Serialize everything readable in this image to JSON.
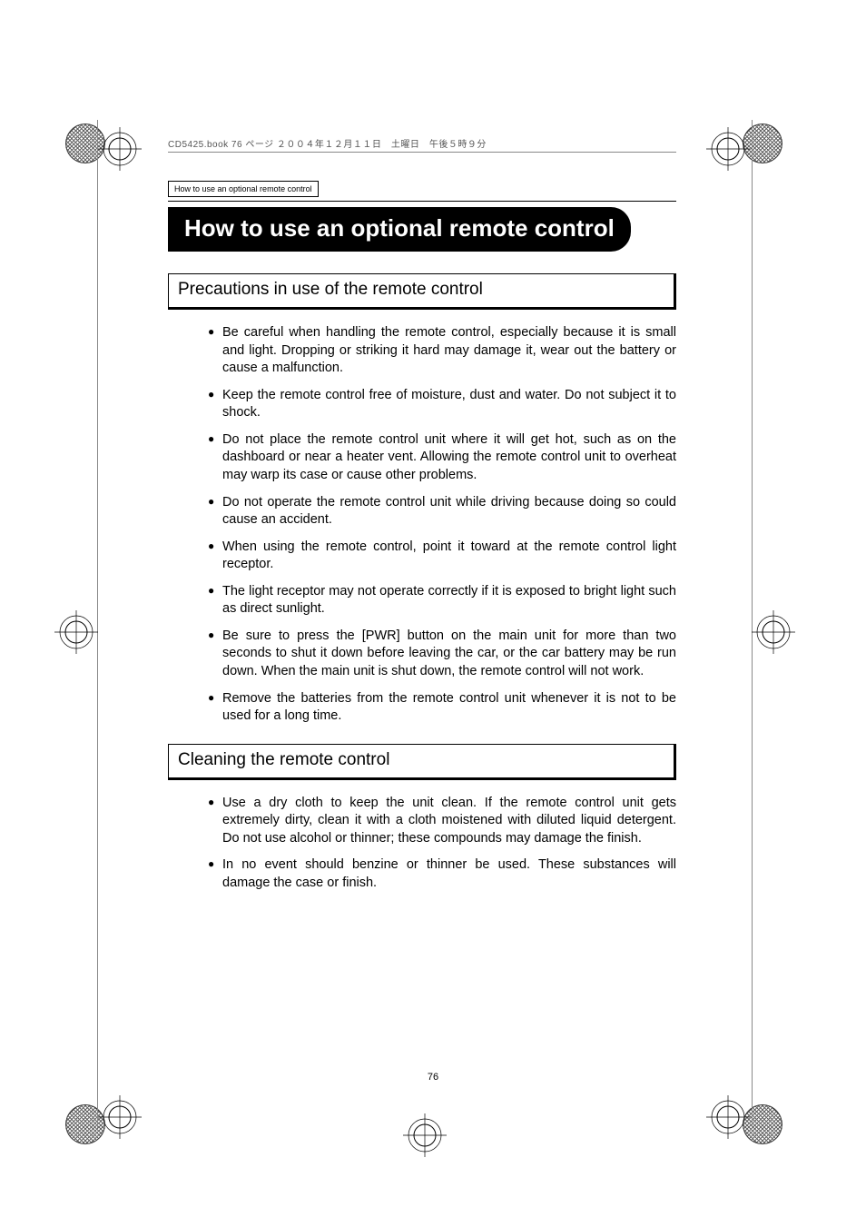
{
  "print_header": "CD5425.book  76 ページ  ２００４年１２月１１日　土曜日　午後５時９分",
  "running_head": "How to use an optional remote control",
  "main_title": "How to use an optional remote control",
  "sections": [
    {
      "title": "Precautions in use of the remote control",
      "items": [
        "Be careful when handling the remote control, especially because it is small and light. Dropping or striking it hard may damage it, wear out the battery or cause a malfunction.",
        "Keep the remote control free of moisture, dust and water. Do not subject it to shock.",
        "Do not place the remote control unit where it will get hot, such as on the dashboard or near a heater vent.  Allowing the remote control unit to overheat may warp its case or cause other problems.",
        "Do not operate the remote control unit while driving because doing so could cause an accident.",
        "When using the remote control, point it toward at the remote control light receptor.",
        "The light receptor may not operate correctly if it is exposed to bright light such as direct sunlight.",
        "Be sure to press the [PWR] button on the main unit for more than two seconds to shut it down before leaving the car, or the car battery may be run down. When the main unit is shut down, the remote control will not work.",
        "Remove the batteries from the remote control unit whenever it is not to be used for a long time."
      ]
    },
    {
      "title": "Cleaning the remote control",
      "items": [
        "Use a dry cloth to keep the unit clean.  If the remote control unit gets extremely dirty, clean it with a cloth moistened with diluted liquid detergent.  Do not use alcohol or thinner; these compounds may damage the finish.",
        "In no event should benzine or thinner be used. These substances will damage the case or finish."
      ]
    }
  ],
  "page_number": "76"
}
